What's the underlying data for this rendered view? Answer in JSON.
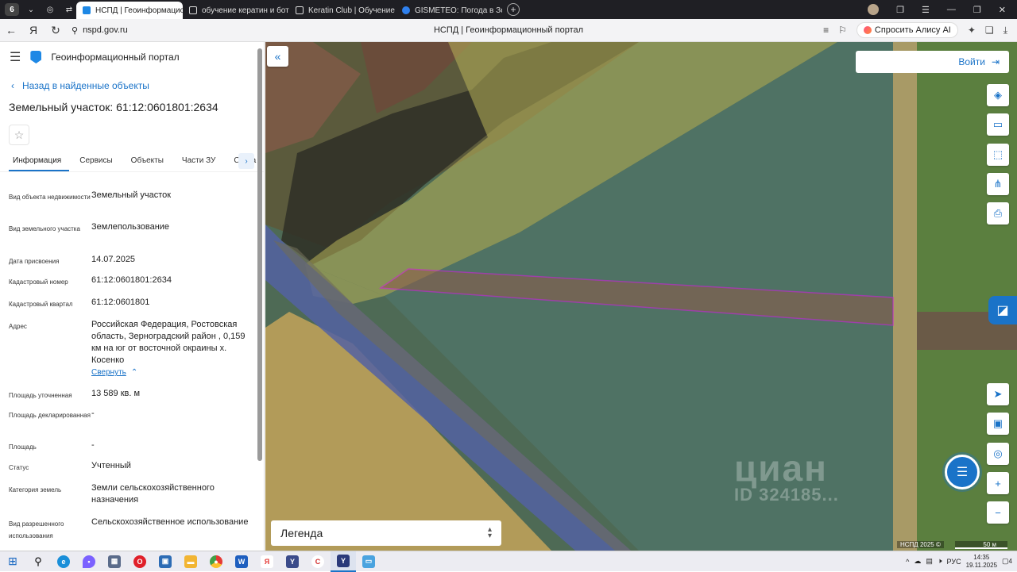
{
  "browser": {
    "tab_count": "6",
    "tabs": [
      {
        "title": "НСПД | Геоинформационный портал",
        "color": "#1e88e5"
      },
      {
        "title": "обучение кератин и ботокс",
        "color": "#dddddd"
      },
      {
        "title": "Keratin Club | Обучение кератину",
        "color": "#dddddd"
      },
      {
        "title": "GISMETEO: Погода в Зерноград",
        "color": "#2f80ed"
      }
    ],
    "url": "nspd.gov.ru",
    "page_title": "НСПД | Геоинформационный портал",
    "alisa_label": "Спросить Алису AI"
  },
  "panel": {
    "portal_name": "Геоинформационный портал",
    "back_label": "Назад в найденные объекты",
    "object_title": "Земельный участок: 61:12:0601801:2634",
    "tabs": [
      "Информация",
      "Сервисы",
      "Объекты",
      "Части ЗУ",
      "Соста"
    ],
    "properties": [
      {
        "k": "Вид объекта недвижимости",
        "v": "Земельный участок"
      },
      {
        "k": "Вид земельного участка",
        "v": "Землепользование"
      },
      {
        "k": "Дата присвоения",
        "v": "14.07.2025"
      },
      {
        "k": "Кадастровый номер",
        "v": "61:12:0601801:2634"
      },
      {
        "k": "Кадастровый квартал",
        "v": "61:12:0601801"
      },
      {
        "k": "Адрес",
        "v": "Российская Федерация, Ростовская область, Зерноградский район , 0,159 км на юг от восточной окраины х. Косенко"
      },
      {
        "k": "Площадь уточненная",
        "v": "13 589 кв. м"
      },
      {
        "k": "Площадь декларированная",
        "v": "-"
      },
      {
        "k": "Площадь",
        "v": "-"
      },
      {
        "k": "Статус",
        "v": "Учтенный"
      },
      {
        "k": "Категория земель",
        "v": "Земли сельскохозяйственного назначения"
      },
      {
        "k": "Вид разрешенного использования",
        "v": "Сельскохозяйственное использование"
      }
    ],
    "collapse_label": "Свернуть"
  },
  "map": {
    "login_label": "Войти",
    "legend_label": "Легенда",
    "watermark": "циан",
    "watermark_id": "ID 324185...",
    "copyright": "НСПД 2025 ©",
    "scale": "50 м"
  },
  "taskbar": {
    "lang": "РУС",
    "time": "14:35",
    "date": "19.11.2025",
    "notifications": "4"
  }
}
